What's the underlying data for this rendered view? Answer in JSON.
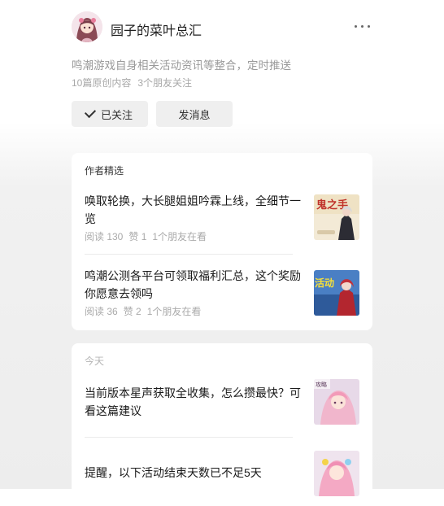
{
  "account": {
    "name": "园子的菜叶总汇",
    "description": "鸣潮游戏自身相关活动资讯等整合，定时推送",
    "stats": [
      "10篇原创内容",
      "3个朋友关注"
    ]
  },
  "buttons": {
    "follow_label": "已关注",
    "message_label": "发消息"
  },
  "picks": {
    "title": "作者精选",
    "articles": [
      {
        "title": "唤取轮换，大长腿姐姐吟霖上线，全细节一览",
        "reads": "阅读 130",
        "likes": "赞 1",
        "friends": "1个朋友在看",
        "thumb_text": "鬼之手"
      },
      {
        "title": "鸣潮公测各平台可领取福利汇总，这个奖励你愿意去领吗",
        "reads": "阅读 36",
        "likes": "赞 2",
        "friends": "1个朋友在看",
        "thumb_text": "活动"
      }
    ]
  },
  "today": {
    "title": "今天",
    "articles": [
      {
        "title": "当前版本星声获取全收集，怎么攒最快？可看这篇建议",
        "thumb_text": "攻略"
      },
      {
        "title": "提醒，以下活动结束天数已不足5天"
      }
    ]
  },
  "colors": {
    "background_top": "#ffffff",
    "background_bottom": "#ededed",
    "button_bg": "#efefef",
    "muted_text": "#a8a8a8"
  }
}
